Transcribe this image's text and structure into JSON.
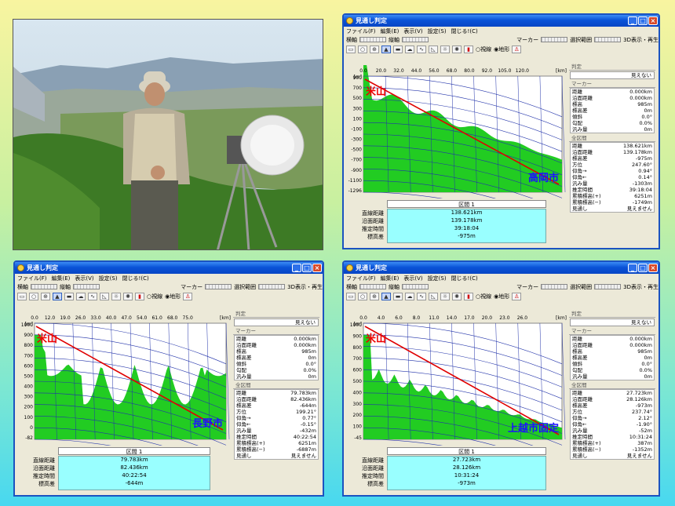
{
  "app_title": "見通し判定",
  "menu": [
    "ファイル(F)",
    "編集(E)",
    "表示(V)",
    "設定(S)",
    "閉じる!(C)"
  ],
  "toolbar": {
    "yoko": "横軸",
    "tate": "縦軸",
    "marker": "マーカー",
    "sentaku": "選択範囲",
    "show3d": "3D表示・再生",
    "shisen": "視線",
    "chikei": "地形"
  },
  "side_labels": {
    "judge": "判定",
    "marker": "マーカー",
    "zen": "全区間",
    "kukan": "区間 1"
  },
  "sum_keys": [
    "直線距離",
    "沿面距離",
    "推定時間",
    "標高差"
  ],
  "marker_keys": [
    "距離",
    "沿面距離",
    "標高",
    "標高差",
    "傾斜",
    "勾配",
    "汎み量"
  ],
  "full_keys": [
    "距離",
    "沿面距離",
    "標高差",
    "方位",
    "仰角→",
    "仰角←",
    "汎み量",
    "推定時間",
    "累積標高(+)",
    "累積標高(−)",
    "見通し"
  ],
  "windows": [
    {
      "x_unit": "[km]",
      "y_unit": "[m]",
      "x_ticks": [
        "0.0",
        "20.0",
        "32.0",
        "44.0",
        "56.0",
        "68.0",
        "80.0",
        "92.0",
        "105.0",
        "120.0"
      ],
      "y_ticks": [
        "900",
        "700",
        "500",
        "300",
        "100",
        "-100",
        "-300",
        "-500",
        "-700",
        "-900",
        "-1100",
        "-1296"
      ],
      "start": "米山",
      "end": "高岡市",
      "judge": "見えない",
      "marker_vals": [
        "0.000km",
        "0.000km",
        "985m",
        "0m",
        "0.0°",
        "0.0%",
        "0m"
      ],
      "full_vals": [
        "138.621km",
        "139.178km",
        "-975m",
        "247.60°",
        "0.94°",
        "0.14°",
        "-1303m",
        "39:18:04",
        "6251m",
        "-1749m",
        "見えません"
      ],
      "sum_vals": [
        "138.621km",
        "139.178km",
        "39:18:04",
        "-975m"
      ]
    },
    {
      "x_unit": "[km]",
      "y_unit": "[m]",
      "x_ticks": [
        "0.0",
        "12.0",
        "19.0",
        "26.0",
        "33.0",
        "40.0",
        "47.0",
        "54.0",
        "61.0",
        "68.0",
        "75.0"
      ],
      "y_ticks": [
        "1000",
        "900",
        "800",
        "700",
        "600",
        "500",
        "400",
        "300",
        "200",
        "100",
        "0",
        "-82"
      ],
      "start": "米山",
      "end": "長野市",
      "judge": "見えない",
      "marker_vals": [
        "0.000km",
        "0.000km",
        "985m",
        "0m",
        "0.0°",
        "0.0%",
        "0m"
      ],
      "full_vals": [
        "79.783km",
        "82.436km",
        "-644m",
        "199.21°",
        "0.77°",
        "-0.15°",
        "-432m",
        "40:22:54",
        "6251m",
        "-6887m",
        "見えません"
      ],
      "sum_vals": [
        "79.783km",
        "82.436km",
        "40:22:54",
        "-644m"
      ]
    },
    {
      "x_unit": "[km]",
      "y_unit": "[m]",
      "x_ticks": [
        "0.0",
        "4.0",
        "6.0",
        "8.0",
        "11.0",
        "14.0",
        "17.0",
        "20.0",
        "23.0",
        "26.0"
      ],
      "y_ticks": [
        "1000",
        "900",
        "800",
        "700",
        "600",
        "500",
        "400",
        "300",
        "200",
        "100",
        "-45"
      ],
      "start": "米山",
      "end": "上越市固定",
      "judge": "見えない",
      "marker_vals": [
        "0.000km",
        "0.000km",
        "985m",
        "0m",
        "0.0°",
        "0.0%",
        "0m"
      ],
      "full_vals": [
        "27.723km",
        "28.126km",
        "-973m",
        "237.74°",
        "2.12°",
        "-1.90°",
        "-52m",
        "10:31:24",
        "387m",
        "-1352m",
        "見えません"
      ],
      "sum_vals": [
        "27.723km",
        "28.126km",
        "10:31:24",
        "-973m"
      ]
    }
  ],
  "colors": {
    "terrain": "#22cc22",
    "line": "#e00000",
    "grid": "#2233aa",
    "label": "#1d10ff",
    "title_bar": "#0a53d8"
  }
}
